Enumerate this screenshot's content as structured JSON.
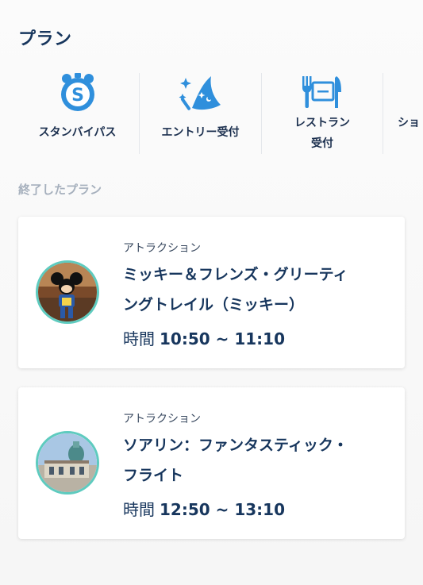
{
  "header": {
    "title": "プラン"
  },
  "shortcuts": [
    {
      "label": "スタンバイパス",
      "icon": "standby-pass-icon"
    },
    {
      "label": "エントリー受付",
      "icon": "wizard-hat-icon"
    },
    {
      "label_line1": "レストラン",
      "label_line2": "受付",
      "icon": "restaurant-icon"
    },
    {
      "label": "ショ",
      "icon": "show-icon"
    }
  ],
  "section": {
    "label": "終了したプラン"
  },
  "plans": [
    {
      "category": "アトラクション",
      "name_line1": "ミッキー＆フレンズ・グリーティ",
      "name_line2": "ングトレイル（ミッキー）",
      "time_label": "時間",
      "time": "10:50 ~ 11:10"
    },
    {
      "category": "アトラクション",
      "name_line1": "ソアリン：ファンタスティック・",
      "name_line2": "フライト",
      "time_label": "時間",
      "time": "12:50 ~ 13:10"
    }
  ],
  "colors": {
    "navy": "#17365d",
    "icon_blue": "#2f8fdc",
    "teal_ring": "#5ecbbf",
    "muted": "#a6b0bd"
  }
}
